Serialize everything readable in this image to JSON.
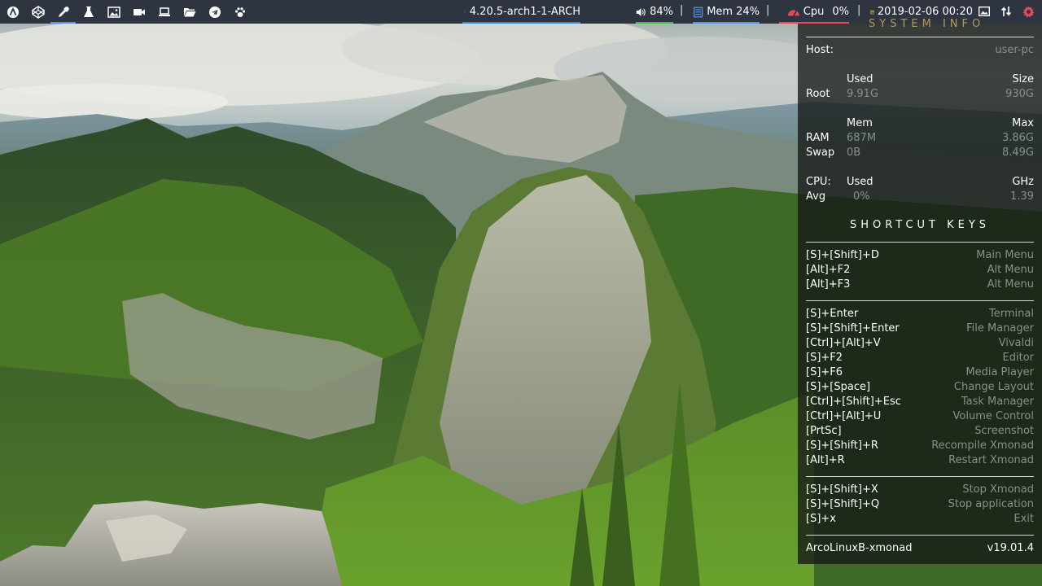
{
  "panel": {
    "launchers": [
      {
        "name": "arcolinux-menu-icon"
      },
      {
        "name": "codepen-icon"
      },
      {
        "name": "eyedropper-icon"
      },
      {
        "name": "flask-icon"
      },
      {
        "name": "image-icon"
      },
      {
        "name": "video-camera-icon"
      },
      {
        "name": "laptop-icon"
      },
      {
        "name": "folder-open-icon"
      },
      {
        "name": "telegram-icon"
      },
      {
        "name": "paw-icon"
      }
    ],
    "window_title": "4.20.5-arch1-1-ARCH",
    "volume": "84%",
    "mem_label": "Mem",
    "mem_value": "24%",
    "cpu_label": "Cpu",
    "cpu_value": "0%",
    "datetime": "2019-02-06 00:20",
    "separator": "|",
    "colors": {
      "background": "#2e3440",
      "title_underline": "#2f8fd8",
      "volume_underline": "#3fbf3f",
      "mem_underline": "#5294e2",
      "cpu_underline": "#e04a5a",
      "cpu_icon": "#e04a5a",
      "mem_icon": "#5294e2",
      "calendar_icon": "#e5b840",
      "gear_icon": "#e04a5a"
    }
  },
  "conky": {
    "top_cut_text": "SYSTEM INFO",
    "host_label": "Host:",
    "host_value": "user-pc",
    "disk": {
      "used_header": "Used",
      "size_header": "Size",
      "root_label": "Root",
      "root_used": "9.91G",
      "root_size": "930G"
    },
    "memory": {
      "mem_header": "Mem",
      "max_header": "Max",
      "ram_label": "RAM",
      "ram_used": "687M",
      "ram_max": "3.86G",
      "swap_label": "Swap",
      "swap_used": "0B",
      "swap_max": "8.49G"
    },
    "cpu": {
      "label": "CPU:",
      "used_header": "Used",
      "ghz_header": "GHz",
      "avg_label": "Avg",
      "avg_used": "0%",
      "avg_ghz": "1.39"
    },
    "shortcuts_title": "SHORTCUT KEYS",
    "group1": [
      {
        "keys": "[S]+[Shift]+D",
        "action": "Main Menu"
      },
      {
        "keys": "[Alt]+F2",
        "action": "Alt Menu"
      },
      {
        "keys": "[Alt]+F3",
        "action": "Alt Menu"
      }
    ],
    "group2": [
      {
        "keys": "[S]+Enter",
        "action": "Terminal"
      },
      {
        "keys": "[S]+[Shift]+Enter",
        "action": "File Manager"
      },
      {
        "keys": "[Ctrl]+[Alt]+V",
        "action": "Vivaldi"
      },
      {
        "keys": "[S]+F2",
        "action": "Editor"
      },
      {
        "keys": "[S]+F6",
        "action": "Media Player"
      },
      {
        "keys": "[S]+[Space]",
        "action": "Change Layout"
      },
      {
        "keys": "[Ctrl]+[Shift]+Esc",
        "action": "Task Manager"
      },
      {
        "keys": "[Ctrl]+[Alt]+U",
        "action": "Volume Control"
      },
      {
        "keys": "[PrtSc]",
        "action": "Screenshot"
      },
      {
        "keys": "[S]+[Shift]+R",
        "action": "Recompile Xmonad"
      },
      {
        "keys": "[Alt]+R",
        "action": "Restart Xmonad"
      }
    ],
    "group3": [
      {
        "keys": "[S]+[Shift]+X",
        "action": "Stop Xmonad"
      },
      {
        "keys": "[S]+[Shift]+Q",
        "action": "Stop application"
      },
      {
        "keys": "[S]+x",
        "action": "Exit"
      }
    ],
    "footer_name": "ArcoLinuxB-xmonad",
    "footer_version": "v19.01.4"
  }
}
